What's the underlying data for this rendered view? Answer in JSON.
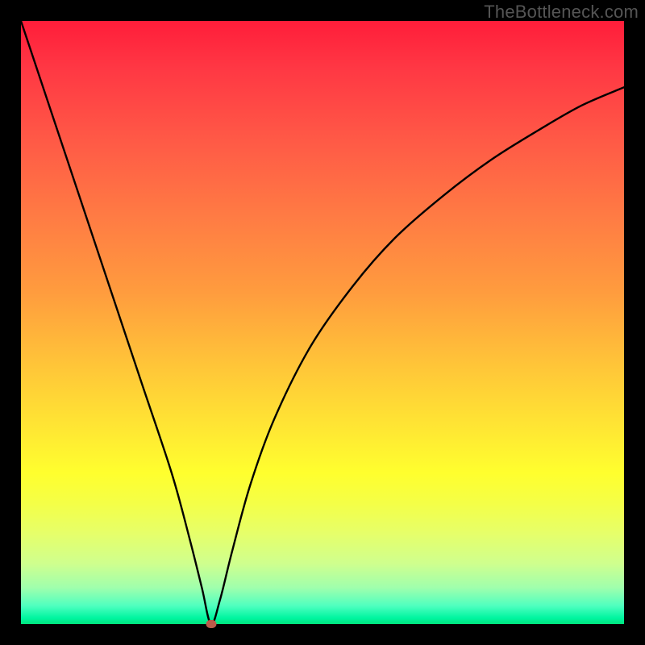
{
  "watermark": "TheBottleneck.com",
  "chart_data": {
    "type": "line",
    "title": "",
    "xlabel": "",
    "ylabel": "",
    "xlim": [
      0,
      100
    ],
    "ylim": [
      0,
      100
    ],
    "grid": false,
    "legend": false,
    "series": [
      {
        "name": "curve",
        "x": [
          0,
          5,
          10,
          15,
          20,
          25,
          28,
          30,
          31.5,
          33,
          35,
          38,
          42,
          48,
          55,
          62,
          70,
          78,
          86,
          93,
          100
        ],
        "y": [
          100,
          85,
          70,
          55,
          40,
          25,
          14,
          6,
          0,
          4,
          12,
          23,
          34,
          46,
          56,
          64,
          71,
          77,
          82,
          86,
          89
        ]
      }
    ],
    "marker": {
      "x": 31.5,
      "y": 0
    },
    "background_gradient": {
      "top": "#ff1d3a",
      "bottom": "#00e57e"
    }
  }
}
